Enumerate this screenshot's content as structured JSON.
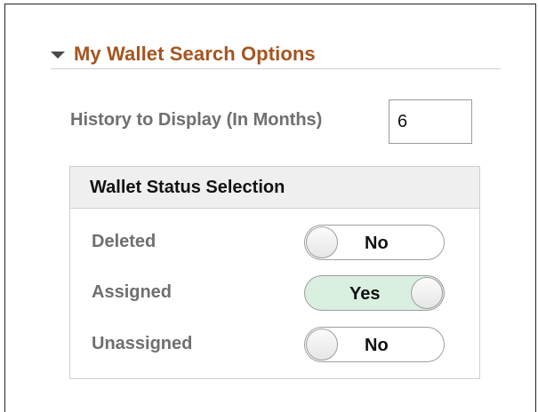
{
  "section": {
    "title": "My Wallet Search Options"
  },
  "history": {
    "label": "History to Display (In Months)",
    "value": "6"
  },
  "status_group": {
    "title": "Wallet Status Selection",
    "rows": [
      {
        "label": "Deleted",
        "toggle_text": "No",
        "state": "off"
      },
      {
        "label": "Assigned",
        "toggle_text": "Yes",
        "state": "on"
      },
      {
        "label": "Unassigned",
        "toggle_text": "No",
        "state": "off"
      }
    ]
  },
  "colors": {
    "section_title": "#a5541f",
    "toggle_on_background": "#d9efe0"
  },
  "icons": {
    "collapse": "caret-down-icon"
  }
}
